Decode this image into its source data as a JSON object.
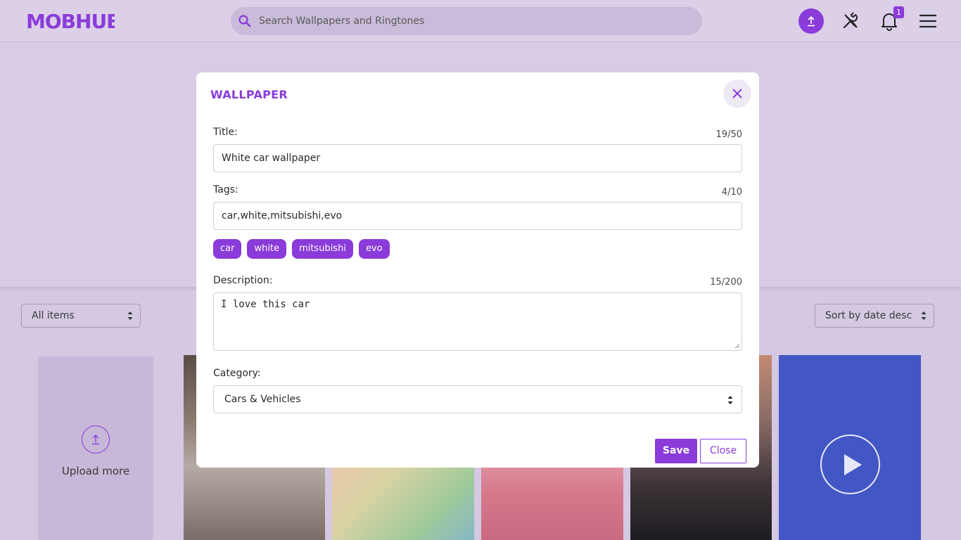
{
  "header": {
    "logo_text": "MOBHUB",
    "search_placeholder": "Search Wallpapers and Ringtones",
    "notification_count": "1",
    "icons": [
      "upload-icon",
      "tools-icon",
      "bell-icon",
      "hamburger-menu-icon",
      "search-icon"
    ]
  },
  "filters": {
    "type_select": "All items",
    "sort_select": "Sort by date desc"
  },
  "gallery": {
    "upload_label": "Upload more"
  },
  "modal": {
    "title": "WALLPAPER",
    "title_label": "Title:",
    "title_count": "19/50",
    "title_value": "White car wallpaper",
    "tags_label": "Tags:",
    "tags_count": "4/10",
    "tags_value": "car,white,mitsubishi,evo",
    "tags": [
      "car",
      "white",
      "mitsubishi",
      "evo"
    ],
    "description_label": "Description:",
    "description_count": "15/200",
    "description_value": "I love this car",
    "category_label": "Category:",
    "category_value": "Cars & Vehicles",
    "save_label": "Save",
    "close_label": "Close"
  },
  "colors": {
    "accent": "#8a3bd9",
    "page_bg": "#d4c8e2",
    "video_card": "#4357c4"
  }
}
